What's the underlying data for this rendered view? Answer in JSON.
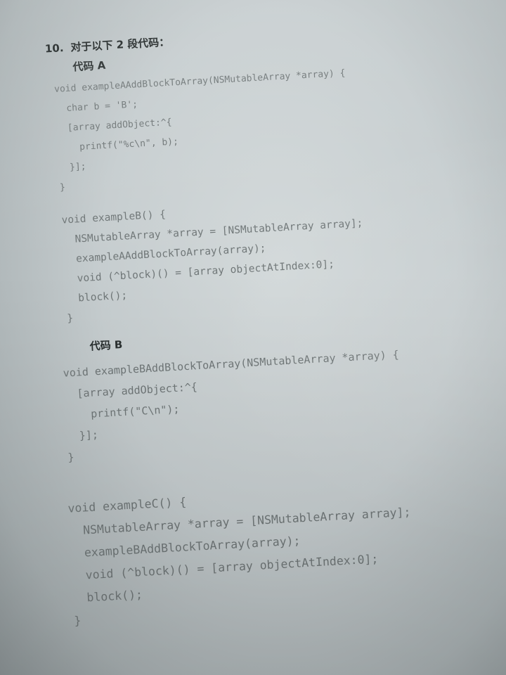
{
  "question": {
    "number": "10.",
    "prompt": "对于以下 2 段代码："
  },
  "snippet_a": {
    "label": "代码 A",
    "add_fn_lines": [
      "void exampleAAddBlockToArray(NSMutableArray *array) {",
      "  char b = 'B';",
      "  [array addObject:^{",
      "    printf(\"%c\\n\", b);",
      "  }];",
      "}"
    ],
    "call_fn_lines": [
      "void exampleB() {",
      "  NSMutableArray *array = [NSMutableArray array];",
      "  exampleAAddBlockToArray(array);",
      "  void (^block)() = [array objectAtIndex:0];",
      "  block();",
      "}"
    ]
  },
  "snippet_b": {
    "label": "代码 B",
    "add_fn_lines": [
      "void exampleBAddBlockToArray(NSMutableArray *array) {",
      "  [array addObject:^{",
      "    printf(\"C\\n\");",
      "  }];",
      "}"
    ],
    "call_fn_lines": [
      "void exampleC() {",
      "  NSMutableArray *array = [NSMutableArray array];",
      "  exampleBAddBlockToArray(array);",
      "  void (^block)() = [array objectAtIndex:0];",
      "  block();",
      "}"
    ]
  }
}
